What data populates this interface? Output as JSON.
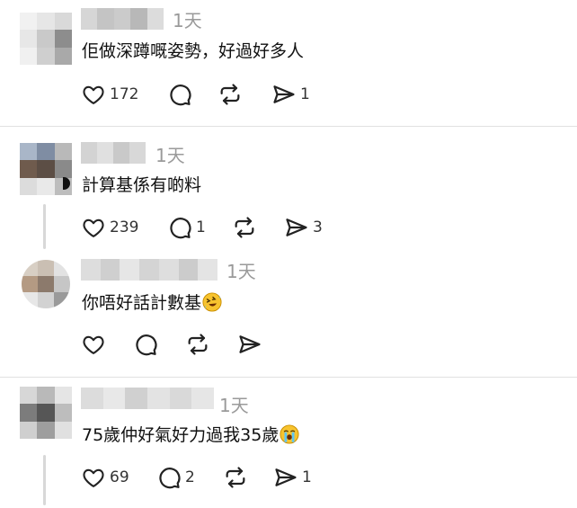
{
  "comments": [
    {
      "time": "1天",
      "text": "佢做深蹲嘅姿勢，好過好多人",
      "emoji": "",
      "counts": {
        "like": "172",
        "reply": "",
        "repost": "",
        "share": "1"
      }
    },
    {
      "time": "1天",
      "text": "計算基係有啲料",
      "emoji": "",
      "counts": {
        "like": "239",
        "reply": "1",
        "repost": "",
        "share": "3"
      }
    },
    {
      "time": "1天",
      "text": "你唔好話計數基",
      "emoji": "rolling-on-floor-laughing-emoji",
      "counts": {
        "like": "",
        "reply": "",
        "repost": "",
        "share": ""
      }
    },
    {
      "time": "1天",
      "text": "75歲仲好氣好力過我35歲",
      "emoji": "loudly-crying-face-emoji",
      "counts": {
        "like": "69",
        "reply": "2",
        "repost": "",
        "share": "1"
      }
    }
  ],
  "icons": {
    "like": "heart-icon",
    "reply": "comment-bubble-icon",
    "repost": "repost-arrows-icon",
    "share": "send-paper-plane-icon"
  },
  "colors": {
    "text": "#111111",
    "muted": "#9a9a9a",
    "divider": "#e1e1e1",
    "icon": "#222222"
  }
}
